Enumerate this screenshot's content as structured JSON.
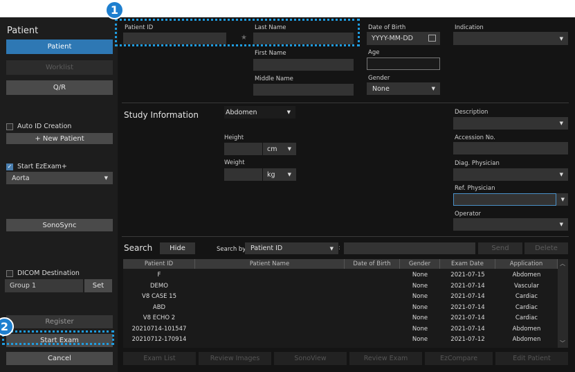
{
  "sidebar": {
    "title": "Patient",
    "patient_button": "Patient",
    "worklist_button": "Worklist",
    "qr_button": "Q/R",
    "auto_id_label": "Auto ID Creation",
    "new_patient_button": "+ New Patient",
    "ezexam_label": "Start EzExam+",
    "ezexam_check": "✓",
    "ezexam_value": "Aorta",
    "sonosync_button": "SonoSync",
    "dicom_label": "DICOM Destination",
    "dicom_group": "Group 1",
    "dicom_set_button": "Set",
    "register_button": "Register",
    "start_exam_button": "Start Exam",
    "cancel_button": "Cancel"
  },
  "patient": {
    "patient_id_label": "Patient ID",
    "patient_id_value": "",
    "last_name_label": "Last Name",
    "last_name_value": "",
    "first_name_label": "First Name",
    "middle_name_label": "Middle Name",
    "dob_label": "Date of Birth",
    "dob_placeholder": "YYYY-MM-DD",
    "age_label": "Age",
    "gender_label": "Gender",
    "gender_value": "None",
    "indication_label": "Indication",
    "star_glyph": "★"
  },
  "study": {
    "title": "Study Information",
    "type_value": "Abdomen",
    "height_label": "Height",
    "height_unit": "cm",
    "weight_label": "Weight",
    "weight_unit": "kg",
    "description_label": "Description",
    "accession_label": "Accession No.",
    "diag_label": "Diag. Physician",
    "ref_label": "Ref. Physician",
    "operator_label": "Operator"
  },
  "search": {
    "title": "Search",
    "hide_button": "Hide",
    "search_by_label": "Search by",
    "search_by_value": "Patient ID",
    "colon": ":",
    "send_button": "Send",
    "delete_button": "Delete",
    "columns": [
      "Patient ID",
      "Patient Name",
      "Date of Birth",
      "Gender",
      "Exam Date",
      "Application"
    ],
    "rows": [
      [
        "F",
        "",
        "",
        "None",
        "2021-07-15",
        "Abdomen"
      ],
      [
        "DEMO",
        "",
        "",
        "None",
        "2021-07-14",
        "Vascular"
      ],
      [
        "V8 CASE 15",
        "",
        "",
        "None",
        "2021-07-14",
        "Cardiac"
      ],
      [
        "ABD",
        "",
        "",
        "None",
        "2021-07-14",
        "Cardiac"
      ],
      [
        "V8 ECHO 2",
        "",
        "",
        "None",
        "2021-07-14",
        "Cardiac"
      ],
      [
        "20210714-101547",
        "",
        "",
        "None",
        "2021-07-14",
        "Abdomen"
      ],
      [
        "20210712-170914",
        "",
        "",
        "None",
        "2021-07-12",
        "Abdomen"
      ]
    ]
  },
  "bottom": {
    "exam_list": "Exam List",
    "review_images": "Review Images",
    "sonoview": "SonoView",
    "review_exam": "Review Exam",
    "ezcompare": "EzCompare",
    "edit_patient": "Edit Patient"
  },
  "callouts": {
    "one": "1",
    "two": "2"
  },
  "colors": {
    "accent_blue": "#2e78b4",
    "callout_blue": "#1e7fcf"
  }
}
